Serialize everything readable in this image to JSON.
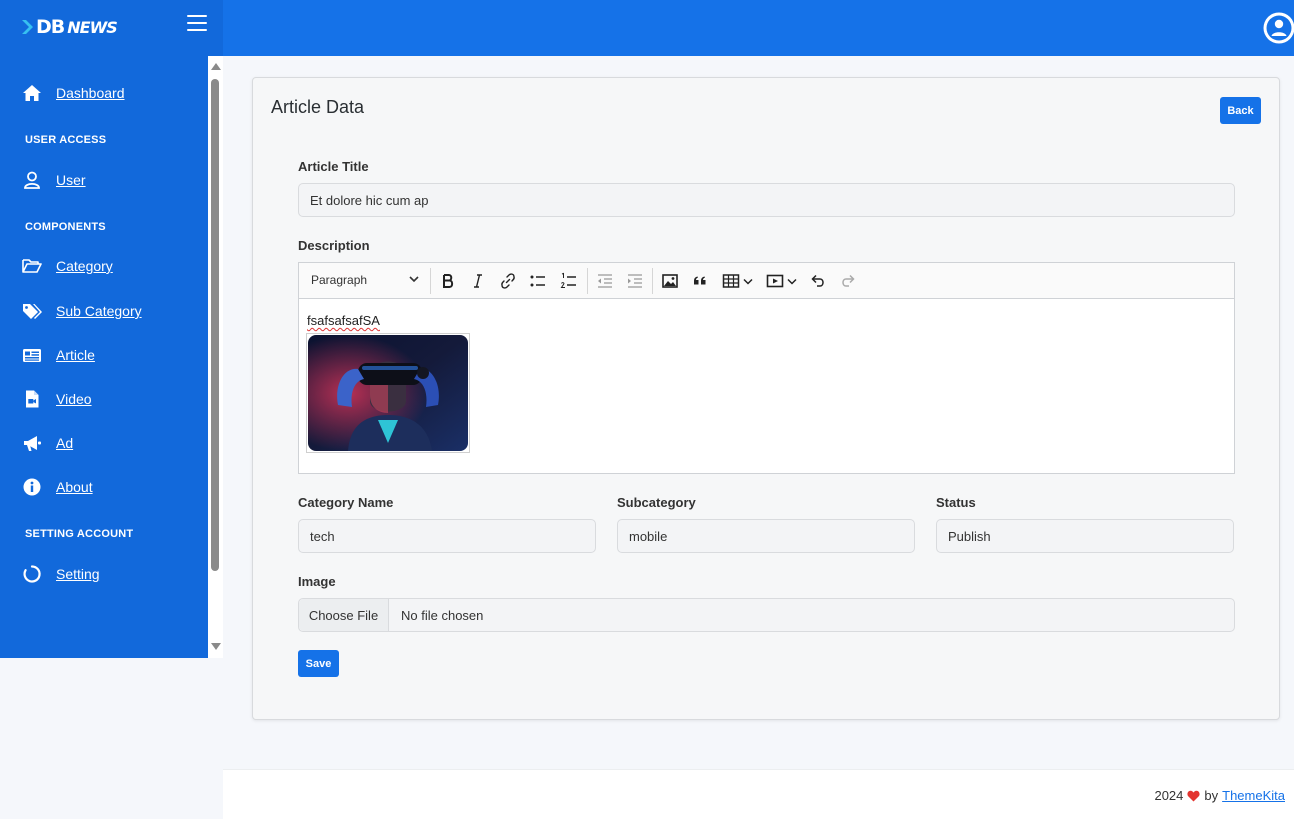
{
  "brand": {
    "logo_db": "DB",
    "logo_news": "NEWS",
    "accent": "#1572e8",
    "sidebar_bg": "#1269db"
  },
  "header": {
    "menu_icon": "hamburger-icon",
    "user_icon": "user-circle-icon"
  },
  "sidebar": {
    "dashboard": "Dashboard",
    "section_user_access": "USER ACCESS",
    "user": "User",
    "section_components": "COMPONENTS",
    "category": "Category",
    "sub_category": "Sub Category",
    "article": "Article",
    "video": "Video",
    "ad": "Ad",
    "about": "About",
    "section_setting_account": "SETTING ACCOUNT",
    "setting": "Setting"
  },
  "card": {
    "title": "Article Data",
    "back_label": "Back",
    "article_title_label": "Article Title",
    "article_title_value": "Et dolore hic cum ap",
    "description_label": "Description",
    "editor": {
      "paragraph_select": "Paragraph",
      "content_text": "fsafsafsafSA",
      "tools": [
        "bold-icon",
        "italic-icon",
        "link-icon",
        "bulleted-list-icon",
        "numbered-list-icon",
        "outdent-icon",
        "indent-icon",
        "image-icon",
        "blockquote-icon",
        "table-icon",
        "media-icon",
        "undo-icon",
        "redo-icon"
      ]
    },
    "category_label": "Category Name",
    "category_value": "tech",
    "subcategory_label": "Subcategory",
    "subcategory_value": "mobile",
    "status_label": "Status",
    "status_value": "Publish",
    "image_label": "Image",
    "choose_file_label": "Choose File",
    "file_status": "No file chosen",
    "save_label": "Save"
  },
  "footer": {
    "year": "2024",
    "by": "by",
    "link": "ThemeKita",
    "heart_color": "#e3342f"
  }
}
